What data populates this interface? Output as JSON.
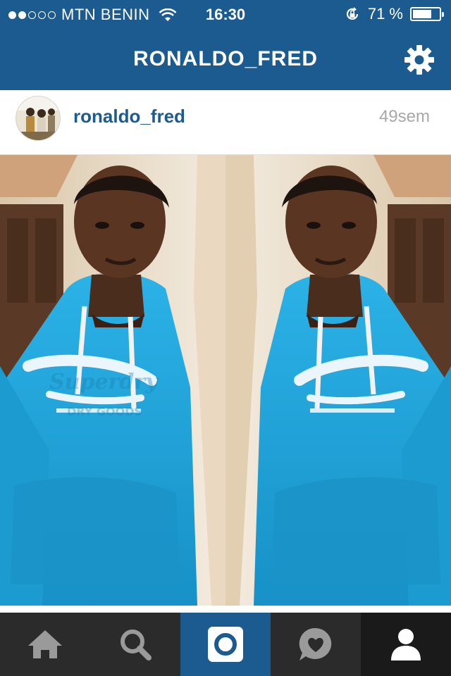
{
  "status_bar": {
    "carrier": "MTN BENIN",
    "signal_dots_filled": 2,
    "signal_dots_total": 5,
    "time": "16:30",
    "battery_text": "71 %",
    "battery_level": 0.71,
    "icons": [
      "wifi-icon",
      "rotation-lock-icon",
      "battery-icon"
    ]
  },
  "nav": {
    "title": "RONALDO_FRED",
    "settings_icon": "gear-icon"
  },
  "post": {
    "username": "ronaldo_fred",
    "time_ago": "49sem",
    "photo_print": {
      "brand": "Superdry",
      "sub": "DRY GOODS"
    }
  },
  "tabs": [
    {
      "name": "home",
      "icon": "home-icon"
    },
    {
      "name": "explore",
      "icon": "search-icon"
    },
    {
      "name": "camera",
      "icon": "camera-icon",
      "active": true
    },
    {
      "name": "news",
      "icon": "heart-bubble-icon"
    },
    {
      "name": "profile",
      "icon": "profile-icon"
    }
  ],
  "colors": {
    "brand_blue": "#1b5b8f",
    "tab_bar": "#2b2b2b",
    "tab_icon": "#9a9a9a",
    "hoodie": "#1fa0d5",
    "time_gray": "#a8a8a8"
  }
}
